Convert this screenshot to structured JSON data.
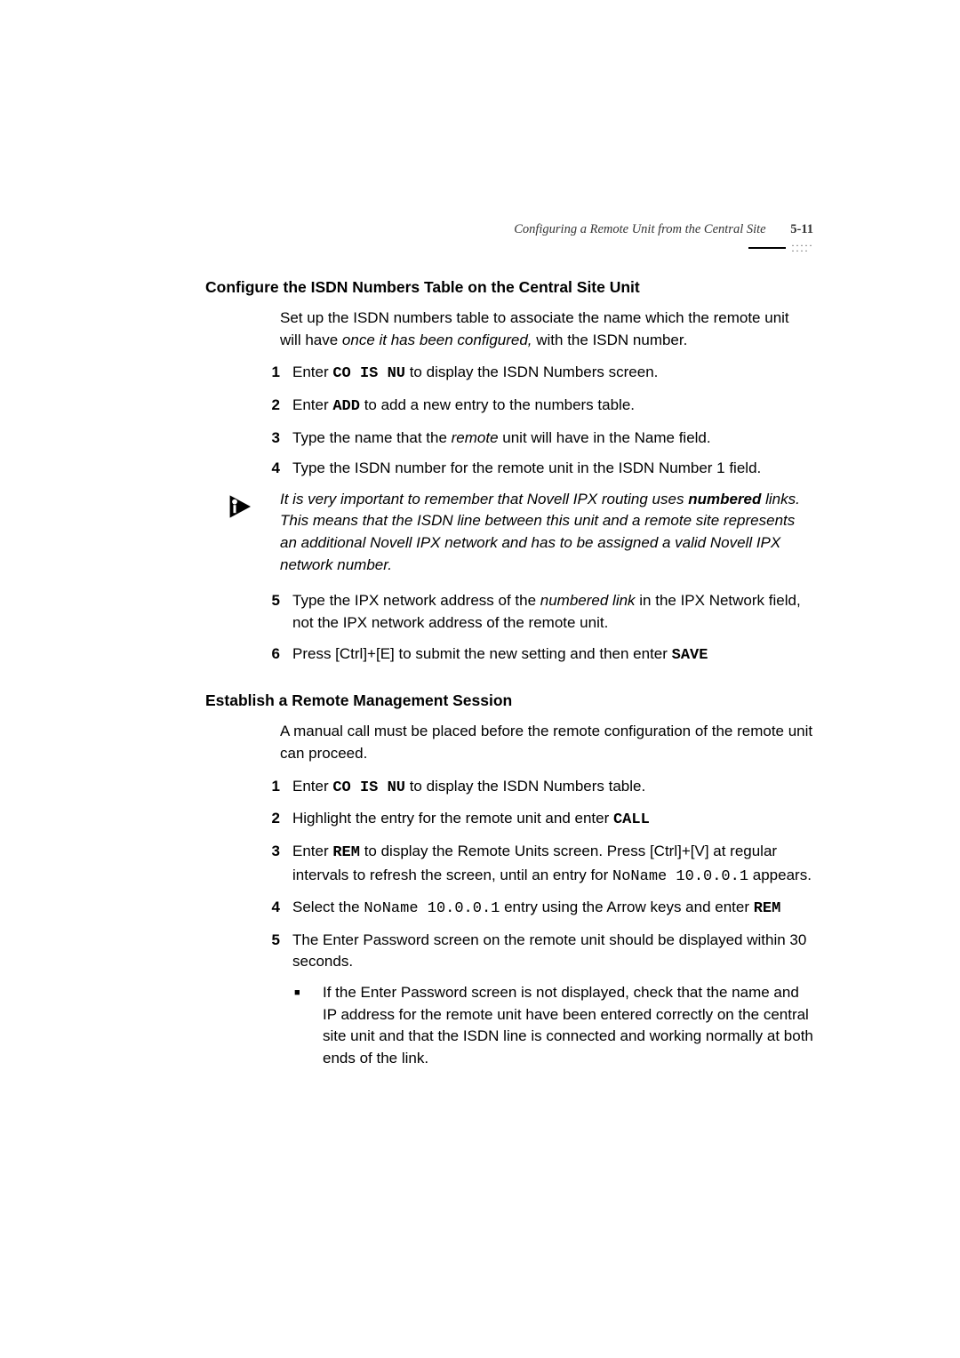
{
  "header": {
    "running_title": "Configuring a Remote Unit from the Central Site",
    "page_number": "5-11"
  },
  "section1": {
    "heading": "Configure the ISDN Numbers Table on the Central Site Unit",
    "intro_pre": "Set up the ISDN numbers table to associate the name which the remote unit will have ",
    "intro_italic": "once it has been configured,",
    "intro_post": " with the ISDN number.",
    "step1": {
      "num": "1",
      "pre": "Enter ",
      "cmd": "CO IS NU",
      "post": " to display the ISDN Numbers screen."
    },
    "step2": {
      "num": "2",
      "pre": "Enter ",
      "cmd": "ADD",
      "post": " to add a new entry to the numbers table."
    },
    "step3": {
      "num": "3",
      "pre": "Type the name that the ",
      "italic": "remote",
      "post": " unit will have in the Name field."
    },
    "step4": {
      "num": "4",
      "text": "Type the ISDN number for the remote unit in the ISDN Number 1 field."
    },
    "note": {
      "pre": "It is very important to remember that Novell IPX routing uses ",
      "bold": "numbered",
      "post": " links. This means that the ISDN line between this unit and a remote site represents an additional Novell IPX network and has to be assigned a valid Novell IPX network number."
    },
    "step5": {
      "num": "5",
      "pre": "Type the IPX network address of the ",
      "italic": "numbered link",
      "post": " in the IPX Network field, not the IPX network address of the remote unit."
    },
    "step6": {
      "num": "6",
      "pre": "Press [Ctrl]+[E] to submit the new setting and then enter ",
      "cmd": "SAVE"
    }
  },
  "section2": {
    "heading": "Establish a Remote Management Session",
    "intro": "A manual call must be placed before the remote configuration of the remote unit can proceed.",
    "step1": {
      "num": "1",
      "pre": "Enter ",
      "cmd": "CO IS NU",
      "post": " to display the ISDN Numbers table."
    },
    "step2": {
      "num": "2",
      "pre": "Highlight the entry for the remote unit and enter ",
      "cmd": "CALL"
    },
    "step3": {
      "num": "3",
      "pre": "Enter ",
      "cmd": "REM",
      "mid": " to display the Remote Units screen. Press [Ctrl]+[V] at regular intervals to refresh the screen, until an entry for ",
      "mono": "NoName 10.0.0.1",
      "post": " appears."
    },
    "step4": {
      "num": "4",
      "pre": "Select the ",
      "mono": "NoName 10.0.0.1",
      "mid": " entry using the Arrow keys and enter ",
      "cmd": "REM"
    },
    "step5": {
      "num": "5",
      "text": "The Enter Password screen on the remote unit should be displayed within 30 seconds.",
      "bullet": "If the Enter Password screen is not displayed, check that the name and IP address for the remote unit have been entered correctly on the central site unit and that the ISDN line is connected and working normally at both ends of the link."
    }
  }
}
